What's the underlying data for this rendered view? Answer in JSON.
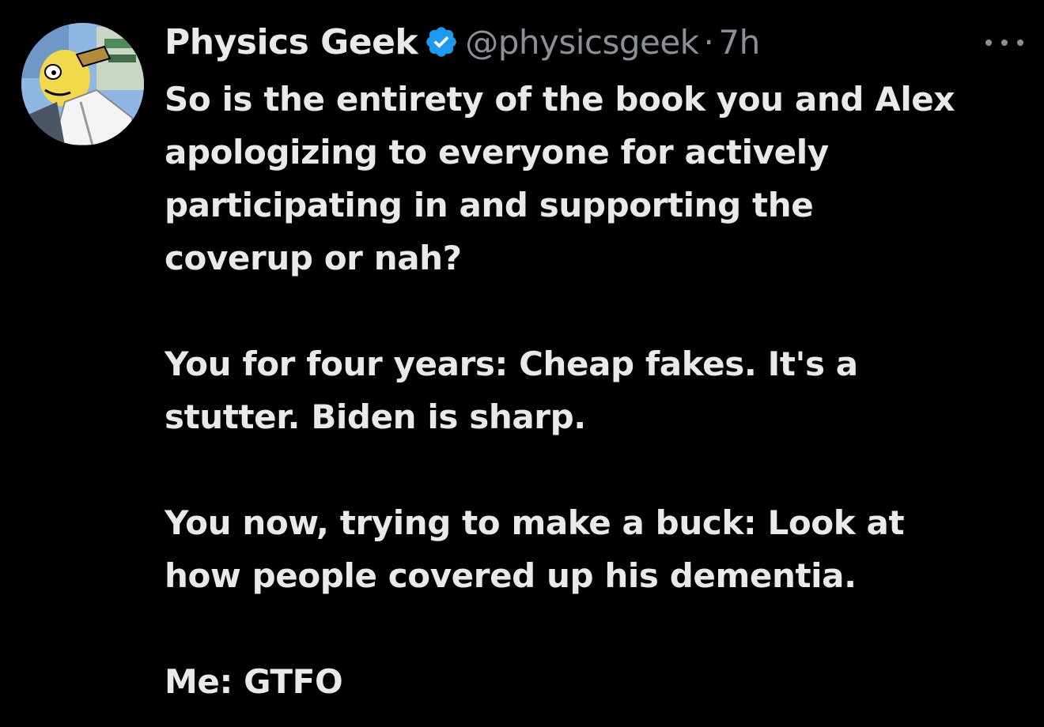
{
  "tweet": {
    "author": {
      "display_name": "Physics Geek",
      "handle": "@physicsgeek",
      "verified": true,
      "avatar_icon": "cartoon-character-avatar"
    },
    "separator": "·",
    "time": "7h",
    "more_icon": "ellipsis-icon",
    "body": {
      "paragraphs": [
        [
          "So is the entirety of the book you and Alex",
          "apologizing to everyone for actively",
          "participating in and supporting the",
          "coverup or nah?"
        ],
        [
          "You for four years: Cheap fakes. It's a",
          "stutter. Biden is sharp."
        ],
        [
          "You now, trying to make a buck: Look at",
          "how people covered up his dementia."
        ],
        [
          "Me: GTFO"
        ]
      ]
    }
  },
  "colors": {
    "background": "#000000",
    "text": "#e7e9ea",
    "secondary": "#8b9096",
    "verified": "#1d9bf0"
  }
}
